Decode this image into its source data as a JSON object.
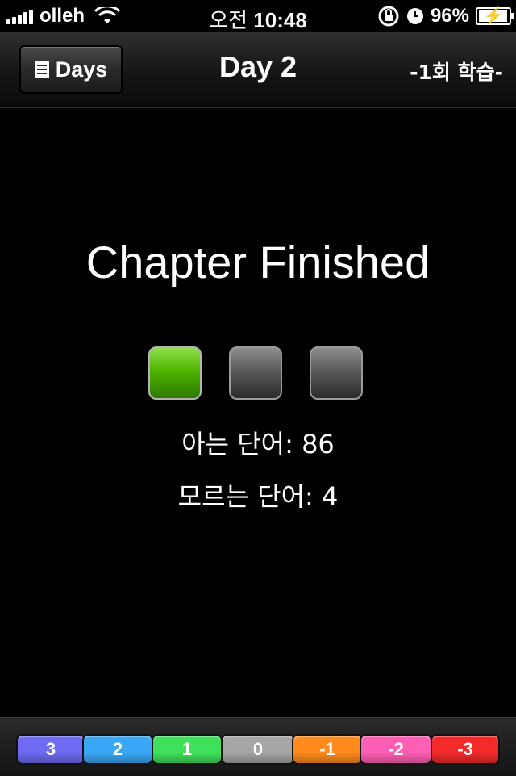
{
  "status_bar": {
    "carrier": "olleh",
    "time_prefix": "오전",
    "time": "10:48",
    "battery": "96%",
    "battery_level": 0.96
  },
  "nav": {
    "back_label": "Days",
    "title": "Day 2",
    "right_label": "-1회 학습-"
  },
  "main": {
    "heading": "Chapter Finished",
    "indicators": [
      "on",
      "off",
      "off"
    ],
    "known_words": "아는 단어: 86",
    "unknown_words": "모르는 단어: 4"
  },
  "bottom_bar": {
    "segments": [
      {
        "label": "3",
        "color": "#6f6bf2"
      },
      {
        "label": "2",
        "color": "#3aa7f5"
      },
      {
        "label": "1",
        "color": "#3fe05a"
      },
      {
        "label": "0",
        "color": "#a6a6a6"
      },
      {
        "label": "-1",
        "color": "#ff8a1e"
      },
      {
        "label": "-2",
        "color": "#ff5fb4"
      },
      {
        "label": "-3",
        "color": "#f22a2a"
      }
    ]
  }
}
